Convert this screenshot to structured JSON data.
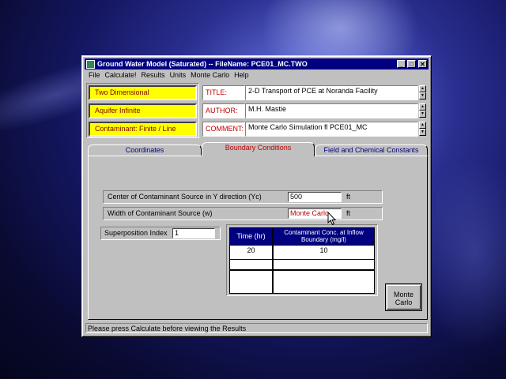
{
  "window": {
    "title": "Ground Water Model (Saturated) -- FileName: PCE01_MC.TWO",
    "min_glyph": "_",
    "max_glyph": "□",
    "close_glyph": "✕"
  },
  "menu": [
    "File",
    "Calculate!",
    "Results",
    "Units",
    "Monte Carlo",
    "Help"
  ],
  "left_buttons": [
    "Two Dimensional",
    "Aquifer Infinite",
    "Contaminant: Finite / Line"
  ],
  "info": {
    "title_label": "TITLE:",
    "title_value": "2-D Transport of PCE at Noranda Facility",
    "author_label": "AUTHOR:",
    "author_value": "M.H. Mastie",
    "comment_label": "COMMENT:",
    "comment_value": "Monte Carlo Simulation fl PCE01_MC"
  },
  "tabs": [
    "Coordinates",
    "Boundary Conditions",
    "Field and Chemical Constants"
  ],
  "fields": {
    "center_label": "Center of Contaminant Source in Y direction (Yc)",
    "center_value": "500",
    "center_unit": "ft",
    "width_label": "Width of Contaminant Source (w)",
    "width_value": "Monte Carlo",
    "width_unit": "ft",
    "superposition_label": "Superposition Index",
    "superposition_value": "1"
  },
  "table": {
    "headers": [
      "Time (hr)",
      "Contaminant Conc. at Inflow Boundary (mg/l)"
    ],
    "rows": [
      [
        "20",
        "10"
      ],
      [
        "",
        ""
      ],
      [
        "",
        ""
      ]
    ]
  },
  "monte_carlo_button": "Monte Carlo",
  "status": "Please press Calculate before viewing the Results",
  "colors": {
    "title_bar": "#000080",
    "yellow_button": "#ffff00",
    "label_red": "#c00000",
    "table_header": "#000080"
  }
}
